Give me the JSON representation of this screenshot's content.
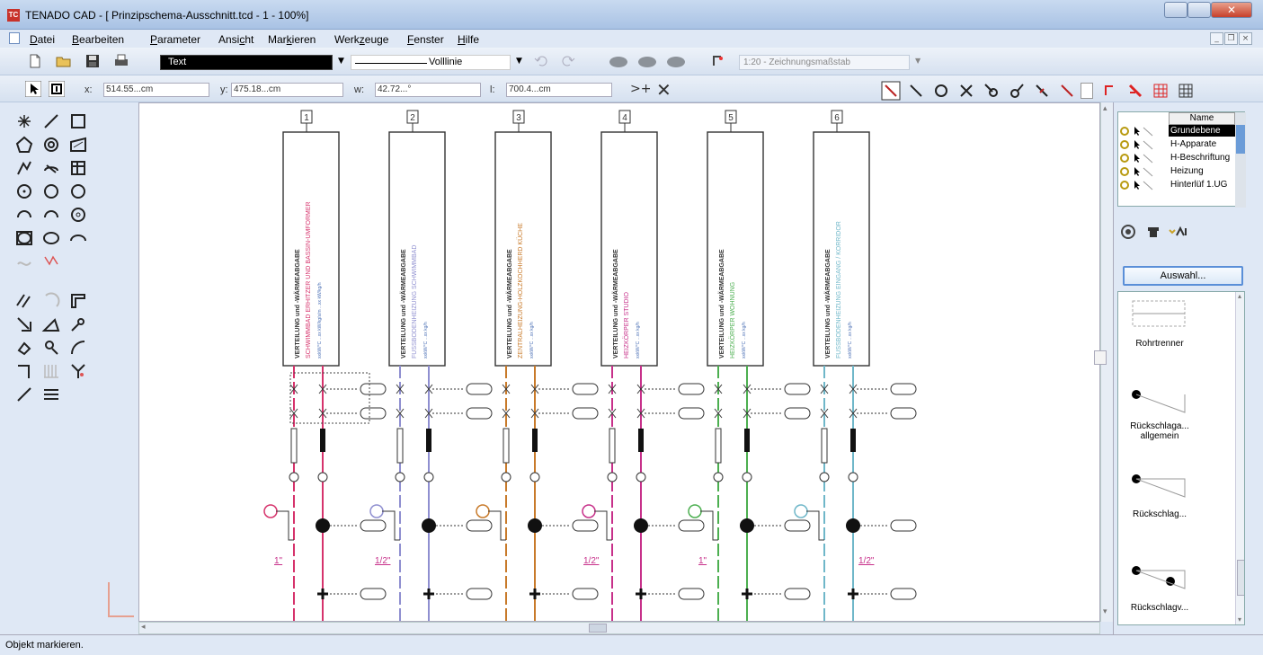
{
  "window": {
    "title": "TENADO CAD - [ Prinzipschema-Ausschnitt.tcd - 1 - 100%]",
    "app_icon_text": "TC"
  },
  "menu": [
    {
      "label": "Datei",
      "accel": "D"
    },
    {
      "label": "Bearbeiten",
      "accel": "B"
    },
    {
      "label": "Parameter",
      "accel": "P"
    },
    {
      "label": "Ansicht",
      "accel": "c"
    },
    {
      "label": "Markieren",
      "accel": "k"
    },
    {
      "label": "Werkzeuge",
      "accel": "z"
    },
    {
      "label": "Fenster",
      "accel": "F"
    },
    {
      "label": "Hilfe",
      "accel": "H"
    }
  ],
  "toolbar": {
    "layer_value": "Text",
    "line_style_value": "Volllinie",
    "scale_value": "1:20 - Zeichnungsmaßstab"
  },
  "coords": {
    "x_label": "x:",
    "x_value": "514.55...cm",
    "y_label": "y:",
    "y_value": "475.18...cm",
    "w_label": "w:",
    "w_value": "42.72...°",
    "l_label": "l:",
    "l_value": "700.4...cm"
  },
  "drawing": {
    "columns": [
      {
        "num": "1",
        "color": "#d6336c",
        "title": "VERTEILUNG und -WÄRMEABGABE",
        "sub": "SCHWIMMBAD ERHITZER UND BASSIN-UMFORMER",
        "detail": "xxkW/°C  ...xx kW/kg/s/m  ...xx kW/kg/h"
      },
      {
        "num": "2",
        "color": "#8f8fd0",
        "title": "VERTEILUNG und -WÄRMEABGABE",
        "sub": "FUSSBODENHEIZUNG SCHWIMMBAD",
        "detail": "xxkW/°C  ...xx kg/h"
      },
      {
        "num": "3",
        "color": "#c87a2a",
        "title": "VERTEILUNG und -WÄRMEABGABE",
        "sub": "ZENTRALHEIZUNG-HOLZKOCHHERD KÜCHE",
        "detail": "xxkW/°C  ...xx kg/h"
      },
      {
        "num": "4",
        "color": "#c7308a",
        "title": "VERTEILUNG und -WÄRMEABGABE",
        "sub": "HEIZKÖRPER STUDIO",
        "detail": "xxkW/°C  ...xx kg/h"
      },
      {
        "num": "5",
        "color": "#4caf50",
        "title": "VERTEILUNG und -WÄRMEABGABE",
        "sub": "HEIZKÖRPER WOHNUNG",
        "detail": "xxkW/°C  ...xx kg/h"
      },
      {
        "num": "6",
        "color": "#6fb7c9",
        "title": "VERTEILUNG und -WÄRMEABGABE",
        "sub": "FUSSBODENHEIZUNG EINGANG / KORRIDOR",
        "detail": "xxkW/°C  ...xx kg/h"
      }
    ],
    "pipe_sizes": [
      "1\"",
      "1/2\"",
      "1/2\"",
      "1\"",
      "1/2\""
    ]
  },
  "layers": {
    "header": "Name",
    "items": [
      "Grundebene",
      "H-Apparate",
      "H-Beschriftung",
      "Heizung",
      "Hinterlüf 1.UG"
    ],
    "selected_index": 0
  },
  "symbols": {
    "button": "Auswahl...",
    "items": [
      "Rohrtrenner",
      "Rückschlaga... allgemein",
      "Rückschlag...",
      "Rückschlagv..."
    ]
  },
  "status": {
    "text": "Objekt markieren."
  },
  "colors": {
    "accent": "#5a8fd8",
    "frame": "#dfe8f5"
  }
}
